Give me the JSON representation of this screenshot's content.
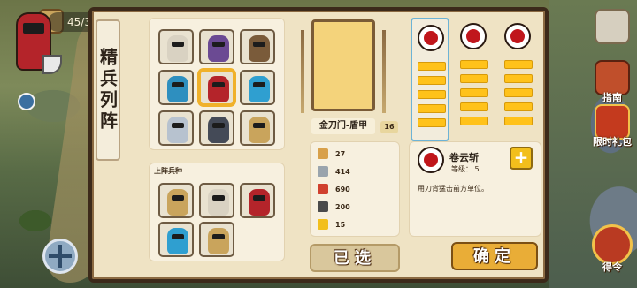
{
  "hud": {
    "counter": "45/3",
    "guide_label": "指南",
    "gift_label": "限时礼包",
    "order_label": "得令"
  },
  "panel": {
    "title": "精兵列阵",
    "lineup_label": "上阵兵种"
  },
  "soldiers": [
    {
      "name": "soldier-white-helm",
      "color": "#d9d2c2"
    },
    {
      "name": "soldier-purple-mage",
      "color": "#6b4a93"
    },
    {
      "name": "soldier-cannon",
      "color": "#7a5b3a"
    },
    {
      "name": "soldier-blue-dragon",
      "color": "#2e8fbf"
    },
    {
      "name": "soldier-red-shield",
      "color": "#b4242a"
    },
    {
      "name": "soldier-blue-knight",
      "color": "#2f9fd0"
    },
    {
      "name": "soldier-silver-knight",
      "color": "#b7c2cf"
    },
    {
      "name": "soldier-dark-knight",
      "color": "#444a57"
    },
    {
      "name": "soldier-lion-warrior",
      "color": "#c9a45c"
    }
  ],
  "lineup": [
    {
      "name": "lineup-gold-knight",
      "color": "#c9a45c"
    },
    {
      "name": "lineup-white-knight",
      "color": "#d9d2c2"
    },
    {
      "name": "lineup-red-shield",
      "color": "#b4242a"
    },
    {
      "name": "lineup-blue-knight",
      "color": "#2f9fd0"
    },
    {
      "name": "lineup-lion-warrior",
      "color": "#c9a45c"
    }
  ],
  "unit": {
    "name": "金刀门-盾甲",
    "level": "16",
    "stats": [
      {
        "icon": "sword-icon",
        "value": "27",
        "color": "#d8a04a"
      },
      {
        "icon": "shield-icon",
        "value": "414",
        "color": "#9aa4ad"
      },
      {
        "icon": "heart-icon",
        "value": "690",
        "color": "#d0402e"
      },
      {
        "icon": "armor-icon",
        "value": "200",
        "color": "#4a4a4a"
      },
      {
        "icon": "lightning-icon",
        "value": "15",
        "color": "#f2bf1c"
      }
    ]
  },
  "skills": {
    "columns": 3,
    "slots_per_column": 5,
    "detail": {
      "name": "卷云斩",
      "level_text": "等级：  5",
      "description": "用刀背猛击前方单位。"
    }
  },
  "buttons": {
    "selected": "已选",
    "confirm": "确定"
  }
}
